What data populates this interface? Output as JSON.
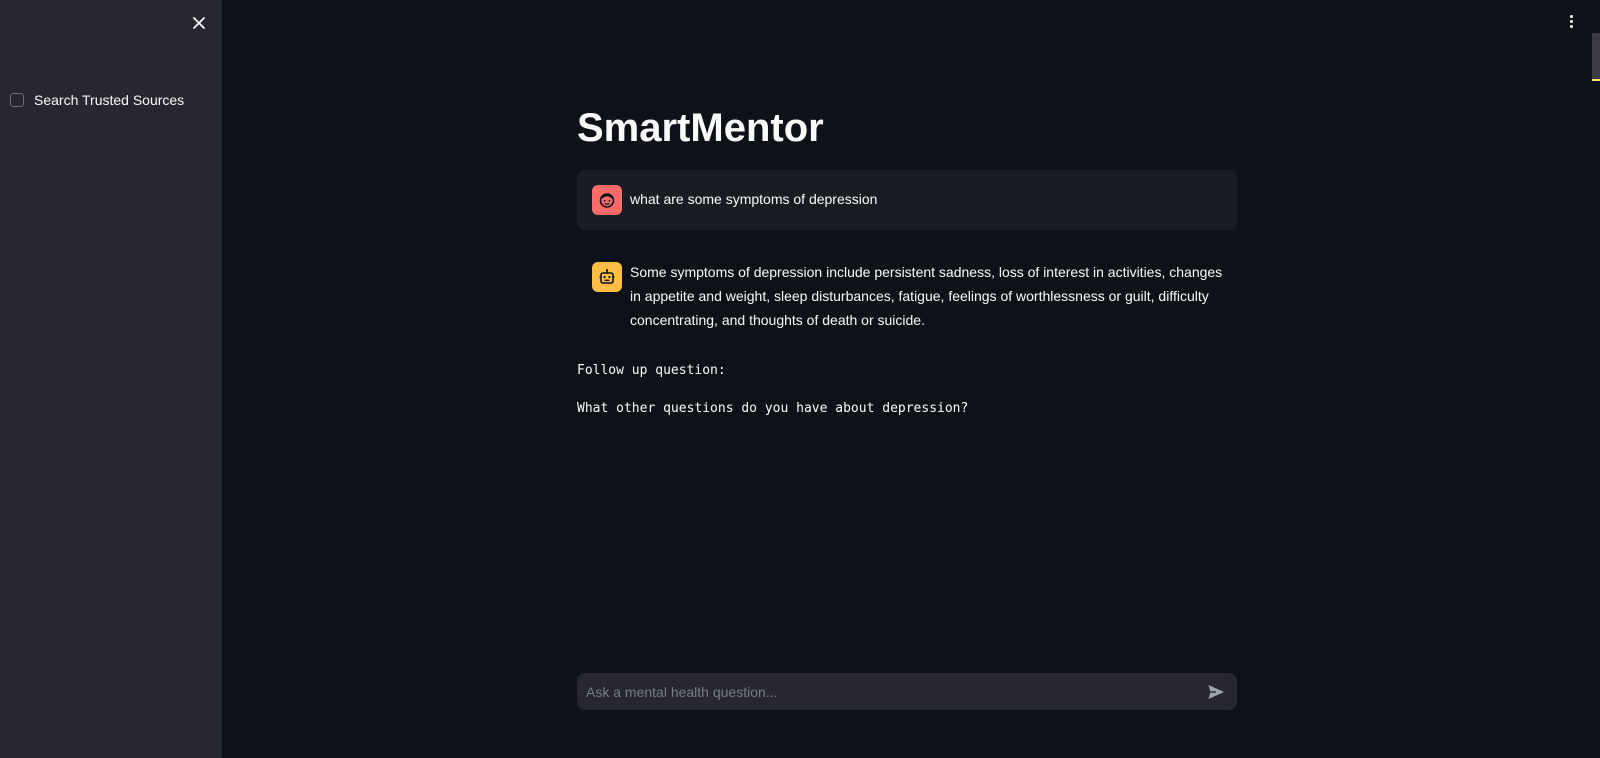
{
  "sidebar": {
    "close_icon": "close-icon",
    "checkbox": {
      "label": "Search Trusted Sources",
      "checked": false
    }
  },
  "header": {
    "menu_icon": "vertical-dots-icon"
  },
  "main": {
    "title": "SmartMentor",
    "messages": [
      {
        "role": "user",
        "avatar_icon": "user-face-icon",
        "avatar_color": "#ff6b6b",
        "text": "what are some symptoms of depression"
      },
      {
        "role": "assistant",
        "avatar_icon": "robot-icon",
        "avatar_color": "#ffbd45",
        "text": "Some symptoms of depression include persistent sadness, loss of interest in activities, changes in appetite and weight, sleep disturbances, fatigue, feelings of worthlessness or guilt, difficulty concentrating, and thoughts of death or suicide."
      }
    ],
    "follow_up_label": "Follow up question:",
    "follow_up_question": "What other questions do you have about depression?"
  },
  "chat_input": {
    "placeholder": "Ask a mental health question...",
    "value": "",
    "send_icon": "send-icon"
  },
  "colors": {
    "background": "#0e1117",
    "sidebar": "#262730",
    "user_message_bg": "#1a1c24",
    "accent_user": "#ff6b6b",
    "accent_bot": "#ffbd45"
  }
}
